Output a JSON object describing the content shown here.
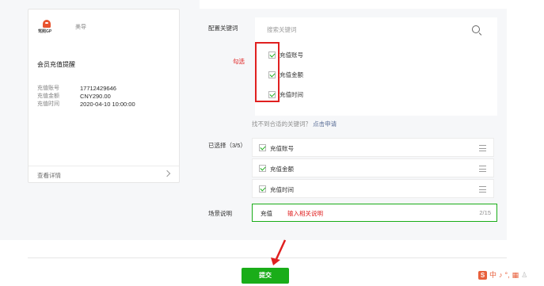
{
  "preview_card": {
    "brand_logo_text": "驾照GP",
    "brand_name": "美导",
    "title": "会员充值提醒",
    "rows": [
      {
        "key": "充值账号",
        "value": "17712429646"
      },
      {
        "key": "充值金额",
        "value": "CNY290.00"
      },
      {
        "key": "充值时间",
        "value": "2020-04-10 10:00:00"
      }
    ],
    "detail_label": "查看详情"
  },
  "form": {
    "keyword_label": "配置关键词",
    "search_placeholder": "搜索关键词",
    "keywords": [
      "充值账号",
      "充值金额",
      "充值时间"
    ],
    "annotation_check": "勾选",
    "not_found_text": "找不到合适的关键词？",
    "not_found_link": "点击申请",
    "selected_label": "已选择（3/5）",
    "selected": [
      "充值账号",
      "充值金额",
      "充值时间"
    ],
    "scene_label": "场景说明",
    "scene_value": "充值",
    "scene_annotation": "输入相关说明",
    "scene_count": "2/15"
  },
  "submit_label": "提交",
  "ime": {
    "s": "S",
    "zh": "中",
    "moon": "♪",
    "dot": "°,",
    "kb": "▦",
    "user": "♙"
  },
  "colors": {
    "accent": "#1aad19",
    "annotation": "#e02020",
    "link": "#576b95"
  }
}
